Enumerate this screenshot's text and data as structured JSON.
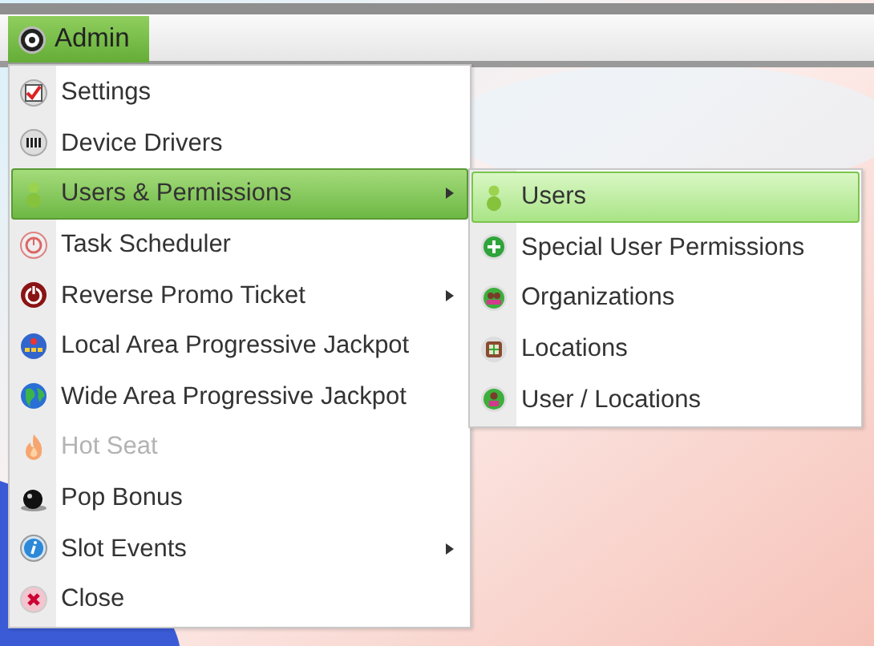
{
  "menubar": {
    "label": "Admin",
    "selected": true
  },
  "menu": [
    {
      "label": "Settings",
      "selected": false,
      "disabled": false,
      "submenu": false
    },
    {
      "label": "Device Drivers",
      "selected": false,
      "disabled": false,
      "submenu": false
    },
    {
      "label": "Users & Permissions",
      "selected": true,
      "disabled": false,
      "submenu": true
    },
    {
      "label": "Task Scheduler",
      "selected": false,
      "disabled": false,
      "submenu": false
    },
    {
      "label": "Reverse Promo Ticket",
      "selected": false,
      "disabled": false,
      "submenu": true
    },
    {
      "label": "Local Area Progressive Jackpot",
      "selected": false,
      "disabled": false,
      "submenu": false
    },
    {
      "label": "Wide Area Progressive Jackpot",
      "selected": false,
      "disabled": false,
      "submenu": false
    },
    {
      "label": "Hot Seat",
      "selected": false,
      "disabled": true,
      "submenu": false
    },
    {
      "label": "Pop Bonus",
      "selected": false,
      "disabled": false,
      "submenu": false
    },
    {
      "label": "Slot Events",
      "selected": false,
      "disabled": false,
      "submenu": true
    },
    {
      "label": "Close",
      "selected": false,
      "disabled": false,
      "submenu": false
    }
  ],
  "submenu": [
    {
      "label": "Users",
      "selected": true
    },
    {
      "label": "Special User Permissions",
      "selected": false
    },
    {
      "label": "Organizations",
      "selected": false
    },
    {
      "label": "Locations",
      "selected": false
    },
    {
      "label": "User / Locations",
      "selected": false
    }
  ]
}
